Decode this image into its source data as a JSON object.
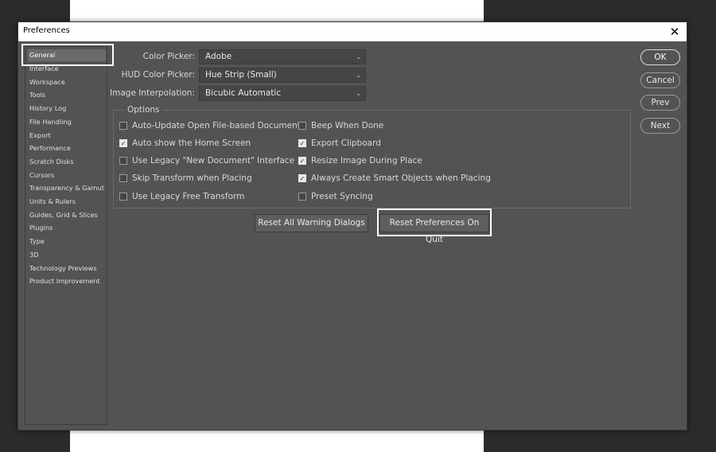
{
  "window": {
    "title": "Preferences",
    "close_glyph": "✕"
  },
  "sidebar": {
    "items": [
      {
        "label": "General",
        "selected": true
      },
      {
        "label": "Interface"
      },
      {
        "label": "Workspace"
      },
      {
        "label": "Tools"
      },
      {
        "label": "History Log"
      },
      {
        "label": "File Handling"
      },
      {
        "label": "Export"
      },
      {
        "label": "Performance"
      },
      {
        "label": "Scratch Disks"
      },
      {
        "label": "Cursors"
      },
      {
        "label": "Transparency & Gamut"
      },
      {
        "label": "Units & Rulers"
      },
      {
        "label": "Guides, Grid & Slices"
      },
      {
        "label": "Plugins"
      },
      {
        "label": "Type"
      },
      {
        "label": "3D"
      },
      {
        "label": "Technology Previews"
      },
      {
        "label": "Product Improvement"
      }
    ]
  },
  "fields": {
    "color_picker": {
      "label": "Color Picker:",
      "value": "Adobe"
    },
    "hud_color_picker": {
      "label": "HUD Color Picker:",
      "value": "Hue Strip (Small)"
    },
    "image_interpolation": {
      "label": "Image Interpolation:",
      "value": "Bicubic Automatic"
    }
  },
  "options": {
    "legend": "Options",
    "left": [
      {
        "label": "Auto-Update Open File-based Documents",
        "checked": false
      },
      {
        "label": "Auto show the Home Screen",
        "checked": true
      },
      {
        "label": "Use Legacy \"New Document\" Interface",
        "checked": false
      },
      {
        "label": "Skip Transform when Placing",
        "checked": false
      },
      {
        "label": "Use Legacy Free Transform",
        "checked": false
      }
    ],
    "right": [
      {
        "label": "Beep When Done",
        "checked": false
      },
      {
        "label": "Export Clipboard",
        "checked": true
      },
      {
        "label": "Resize Image During Place",
        "checked": true
      },
      {
        "label": "Always Create Smart Objects when Placing",
        "checked": true
      },
      {
        "label": "Preset Syncing",
        "checked": false
      }
    ]
  },
  "buttons": {
    "reset_warnings": "Reset All Warning Dialogs",
    "reset_prefs": "Reset Preferences On Quit",
    "ok": "OK",
    "cancel": "Cancel",
    "prev": "Prev",
    "next": "Next"
  },
  "icons": {
    "chevron": "chevron-down-icon",
    "check": "check-icon",
    "close": "close-icon"
  },
  "colors": {
    "dialog_bg": "#535353",
    "highlight": "#ffffff"
  }
}
